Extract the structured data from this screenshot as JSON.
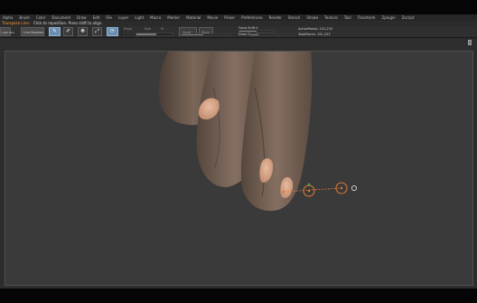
{
  "menu": [
    "Alpha",
    "Brush",
    "Color",
    "Document",
    "Draw",
    "Edit",
    "File",
    "Layer",
    "Light",
    "Macro",
    "Marker",
    "Material",
    "Movie",
    "Picker",
    "Preferences",
    "Render",
    "Stencil",
    "Stroke",
    "Texture",
    "Tool",
    "Transform",
    "Zplugin",
    "Zscript"
  ],
  "hint": {
    "label": "Transpose Line:",
    "text": "Click to reposition. Press shift to align."
  },
  "toolbar": {
    "lightbox_label": "Light Box",
    "preview_label": "Live Boolean",
    "focal_label": "Focal Shift 0",
    "draw_size_label": "Draw Size 64",
    "active_points_label": "ActivePoints: 191,233",
    "total_points_label": "TotalPoints: 191,233",
    "mrgb_label": "Mrgb",
    "rgb_label": "Rgb",
    "m_label": "M",
    "zadd_label": "Zadd",
    "zsub_label": "Zsub",
    "rgb_intensity": 0.55,
    "z_intensity": 0.45,
    "focal_value": 0.0,
    "draw_size_value": 0.18
  },
  "colors": {
    "hint_accent": "#ff9a2e",
    "canvas_bg": "#3b3a3a",
    "skin": "#6e5a4e",
    "nail": "#d8a88a",
    "transpose_line": "#e07a3a",
    "transpose_handle": "#4fa84f"
  }
}
